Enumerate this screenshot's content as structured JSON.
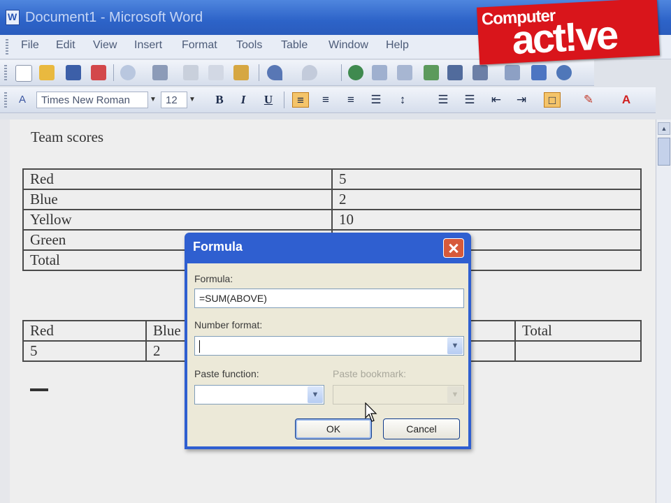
{
  "window": {
    "title": "Document1 - Microsoft Word"
  },
  "menu": [
    "File",
    "Edit",
    "View",
    "Insert",
    "Format",
    "Tools",
    "Table",
    "Window",
    "Help"
  ],
  "format_bar": {
    "font": "Times New Roman",
    "size": "12",
    "bold": "B",
    "italic": "I",
    "underline": "U"
  },
  "logo": {
    "small": "Computer",
    "big": "act!ve"
  },
  "document": {
    "heading": "Team scores",
    "table1": [
      [
        "Red",
        "5"
      ],
      [
        "Blue",
        "2"
      ],
      [
        "Yellow",
        "10"
      ],
      [
        "Green",
        ""
      ],
      [
        "Total",
        ""
      ]
    ],
    "table2": {
      "header": [
        "Red",
        "Blue",
        "",
        "",
        "Total"
      ],
      "row": [
        "5",
        "2",
        "",
        "",
        ""
      ]
    }
  },
  "dialog": {
    "title": "Formula",
    "formula_label": "Formula:",
    "formula_value": "=SUM(ABOVE)",
    "number_format_label": "Number format:",
    "number_format_value": "",
    "paste_function_label": "Paste function:",
    "paste_bookmark_label": "Paste bookmark:",
    "ok": "OK",
    "cancel": "Cancel"
  },
  "colors": {
    "title_bar": "#2d63c8",
    "dialog_frame": "#2f5fd0",
    "logo_red": "#d9151b",
    "active_toggle": "#f4c46a"
  }
}
